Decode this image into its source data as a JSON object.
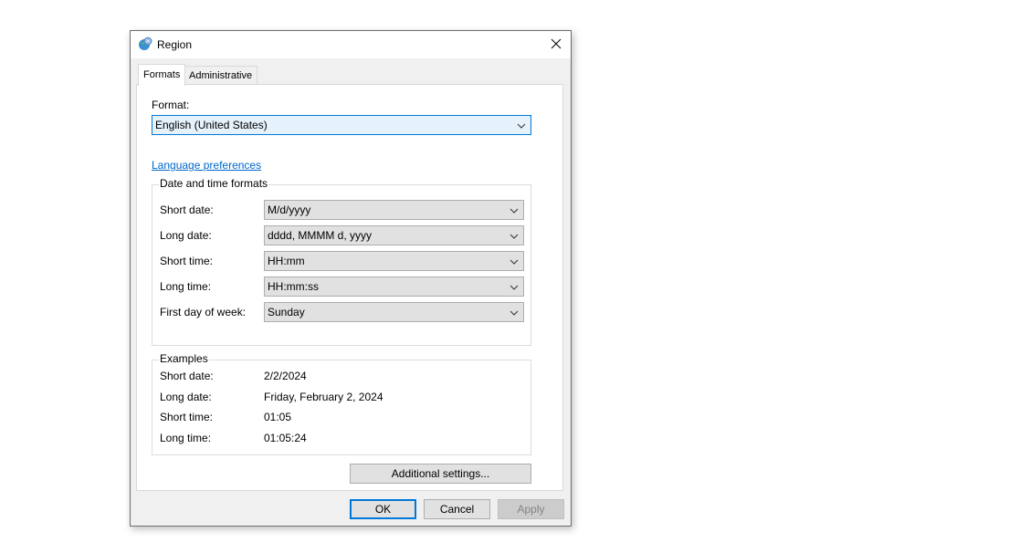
{
  "window": {
    "title": "Region",
    "icon": "globe-region-icon",
    "close_icon": "close-icon"
  },
  "tabs": [
    {
      "label": "Formats",
      "active": true
    },
    {
      "label": "Administrative",
      "active": false
    }
  ],
  "format": {
    "label": "Format:",
    "value": "English (United States)"
  },
  "language_link": "Language preferences",
  "date_time_formats": {
    "title": "Date and time formats",
    "rows": [
      {
        "label": "Short date:",
        "value": "M/d/yyyy"
      },
      {
        "label": "Long date:",
        "value": "dddd, MMMM d, yyyy"
      },
      {
        "label": "Short time:",
        "value": "HH:mm"
      },
      {
        "label": "Long time:",
        "value": "HH:mm:ss"
      },
      {
        "label": "First day of week:",
        "value": "Sunday"
      }
    ]
  },
  "examples": {
    "title": "Examples",
    "rows": [
      {
        "label": "Short date:",
        "value": "2/2/2024"
      },
      {
        "label": "Long date:",
        "value": "Friday, February 2, 2024"
      },
      {
        "label": "Short time:",
        "value": "01:05"
      },
      {
        "label": "Long time:",
        "value": "01:05:24"
      }
    ]
  },
  "buttons": {
    "additional_settings": "Additional settings...",
    "ok": "OK",
    "cancel": "Cancel",
    "apply": "Apply"
  },
  "colors": {
    "accent": "#0078d7",
    "link": "#0066cc",
    "select_bg": "#e5f1fb"
  }
}
